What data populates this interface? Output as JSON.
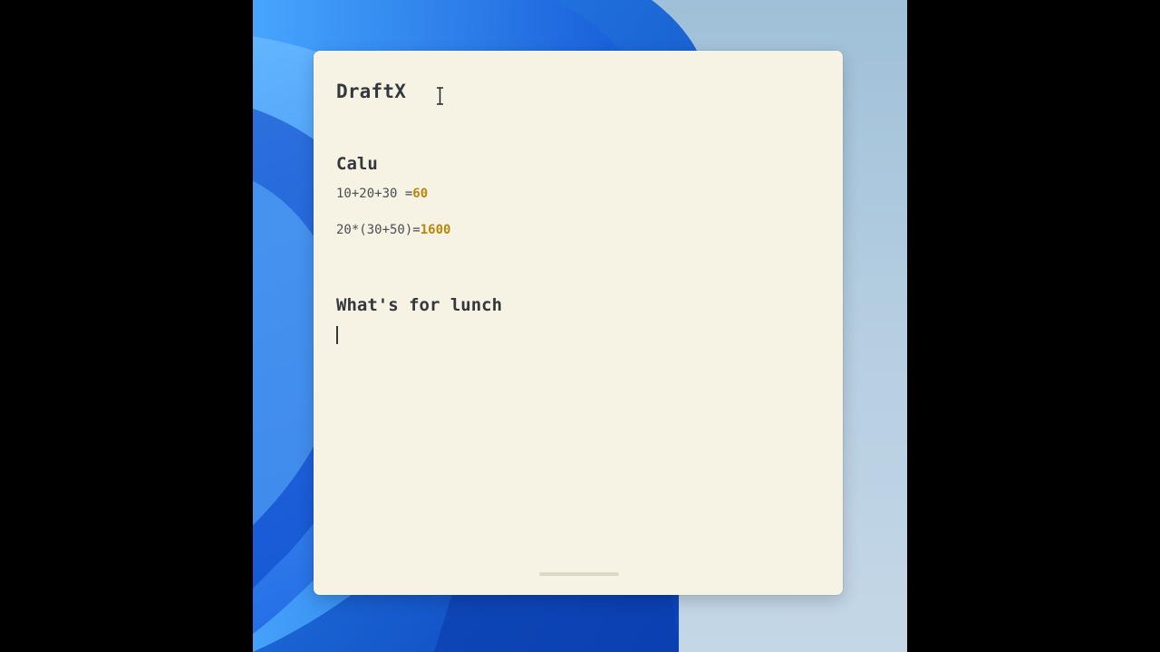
{
  "note": {
    "title": "DraftX",
    "sections": [
      {
        "heading": "Calu",
        "lines": [
          {
            "expression": "10+20+30 =",
            "result": "60"
          },
          {
            "expression": "20*(30+50)=",
            "result": "1600"
          }
        ]
      },
      {
        "heading": "What's for lunch",
        "lines": []
      }
    ]
  },
  "colors": {
    "note_background": "#f6f3e4",
    "result_highlight": "#b8860b",
    "text": "#34373b",
    "wallpaper_accent": "#1565e0"
  },
  "icons": {
    "cursor": "ibeam-cursor-icon"
  }
}
